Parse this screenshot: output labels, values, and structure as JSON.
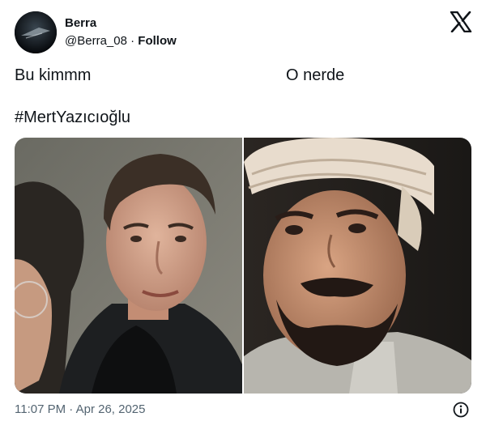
{
  "author": {
    "name": "Berra",
    "handle": "@Berra_08",
    "separator": "·",
    "follow_label": "Follow"
  },
  "tweet": {
    "line1": "Bu kimmm",
    "line2": "O nerde",
    "hashtag": "#MertYazıcıoğlu"
  },
  "meta": {
    "timestamp": "11:07 PM · Apr 26, 2025"
  },
  "icons": {
    "brand": "x-logo-icon",
    "info": "info-icon"
  },
  "colors": {
    "text": "#0f1419",
    "muted": "#536471"
  }
}
